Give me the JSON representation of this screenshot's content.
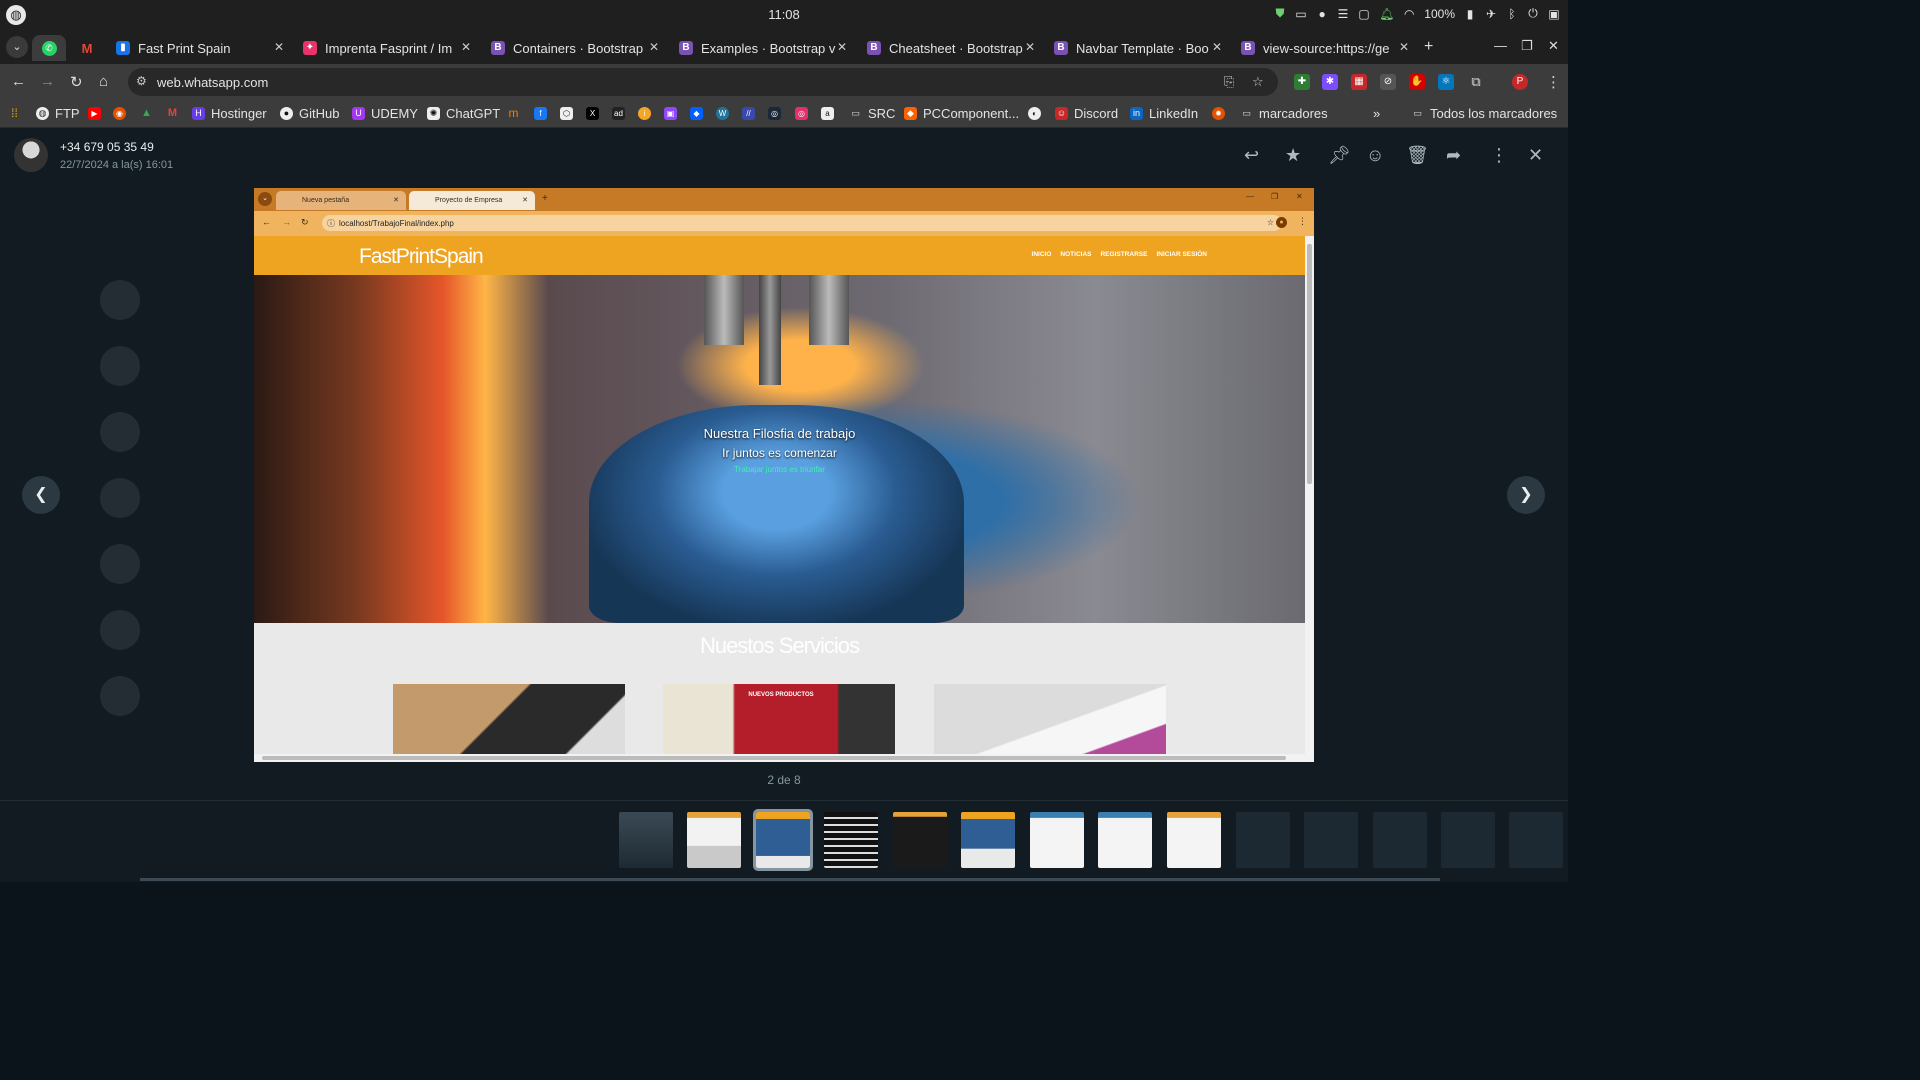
{
  "system": {
    "time": "11:08",
    "battery": "100%"
  },
  "tabs": [
    {
      "label": "Fast Print Spain",
      "icon_color": "#1a73e8",
      "icon_char": "▮"
    },
    {
      "label": "Imprenta Fasprint / Im",
      "icon_color": "#e8336d",
      "icon_char": "✦"
    },
    {
      "label": "Containers · Bootstrap",
      "icon_color": "#7952b3",
      "icon_char": "B"
    },
    {
      "label": "Examples · Bootstrap v",
      "icon_color": "#7952b3",
      "icon_char": "B"
    },
    {
      "label": "Cheatsheet · Bootstrap",
      "icon_color": "#7952b3",
      "icon_char": "B"
    },
    {
      "label": "Navbar Template · Boo",
      "icon_color": "#7952b3",
      "icon_char": "B"
    },
    {
      "label": "view-source:https://ge",
      "icon_color": "#7952b3",
      "icon_char": "B"
    }
  ],
  "address": {
    "url": "web.whatsapp.com"
  },
  "bookmarks": {
    "ftp": "FTP",
    "hostinger": "Hostinger",
    "github": "GitHub",
    "udemy": "UDEMY",
    "chatgpt": "ChatGPT",
    "src": "SRC",
    "pccomponentes": "PCComponent...",
    "discord": "Discord",
    "linkedin": "LinkedIn",
    "marcadores": "marcadores",
    "todos": "Todos los marcadores"
  },
  "viewer": {
    "sender_phone": "+34 679 05 35 49",
    "sender_date": "22/7/2024 a la(s) 16:01",
    "counter": "2 de 8"
  },
  "shot": {
    "tab1": "Nueva pestaña",
    "tab2": "Proyecto de Empresa",
    "url": "localhost/TrabajoFinal/index.php",
    "brand": "FastPrintSpain",
    "nav": [
      "INICIO",
      "NOTICIAS",
      "REGISTRARSE",
      "INICIAR SESIÓN"
    ],
    "hero_line1": "Nuestra Filosfia de trabajo",
    "hero_line2": "Ir juntos es comenzar",
    "hero_line3": "Trabajar juntos es triunfar",
    "services_title": "Nuestos Servicios",
    "card2_label": "NUEVOS PRODUCTOS"
  }
}
